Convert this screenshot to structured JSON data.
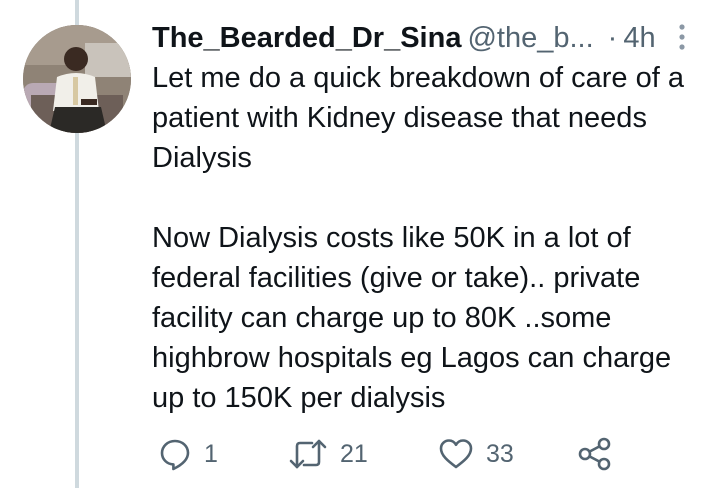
{
  "tweet": {
    "display_name": "The_Bearded_Dr_Sina",
    "handle": "@the_b...",
    "separator": "·",
    "time": "4h",
    "paragraphs": [
      "Let me do a quick breakdown of care of a patient with Kidney disease that needs Dialysis",
      "Now Dialysis costs like 50K in a lot of federal facilities (give or take).. private facility can charge up to 80K ..some highbrow hospitals eg Lagos can charge up to 150K per dialysis"
    ]
  },
  "actions": {
    "reply": {
      "icon": "reply-icon",
      "count": "1"
    },
    "retweet": {
      "icon": "retweet-icon",
      "count": "21"
    },
    "like": {
      "icon": "heart-icon",
      "count": "33"
    },
    "share": {
      "icon": "share-icon"
    }
  },
  "colors": {
    "text": "#0f1419",
    "secondary": "#536471",
    "thread_line": "#cfd9de",
    "background": "#ffffff"
  }
}
